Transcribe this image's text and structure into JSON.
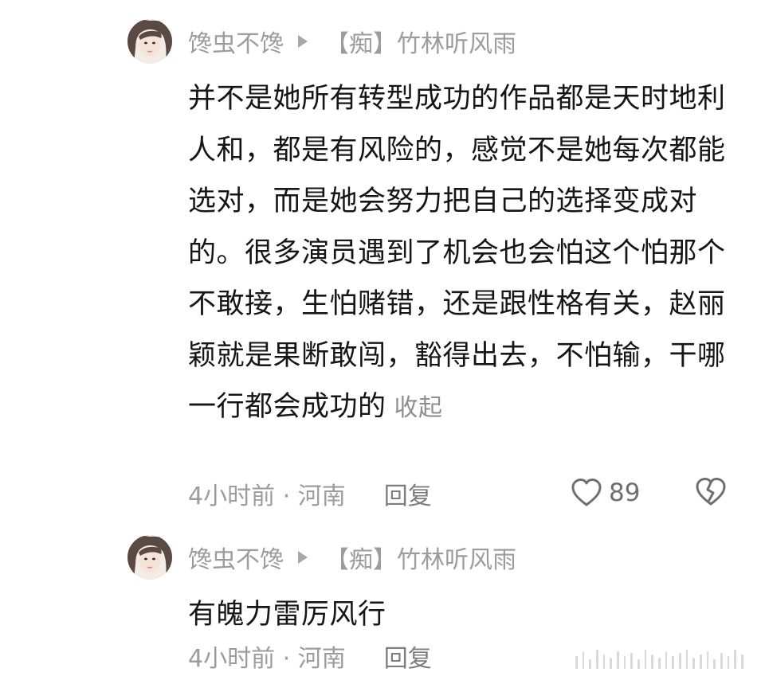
{
  "comments": [
    {
      "author": "馋虫不馋",
      "reply_target": "【痴】竹林听风雨",
      "text": "并不是她所有转型成功的作品都是天时地利人和，都是有风险的，感觉不是她每次都能选对，而是她会努力把自己的选择变成对的。很多演员遇到了机会也会怕这个怕那个不敢接，生怕赌错，还是跟性格有关，赵丽颖就是果断敢闯，豁得出去，不怕输，干哪一行都会成功的",
      "collapse_label": "收起",
      "time_location": "4小时前 · 河南",
      "reply_label": "回复",
      "like_count": "89"
    },
    {
      "author": "馋虫不馋",
      "reply_target": "【痴】竹林听风雨",
      "text": "有魄力雷厉风行",
      "time_location": "4小时前 · 河南",
      "reply_label": "回复"
    }
  ],
  "icons": {
    "reply_arrow": "play-triangle-icon",
    "like": "heart-outline-icon",
    "dislike": "broken-heart-icon",
    "watermark": "barcode-watermark-icon"
  },
  "colors": {
    "text_primary": "#161616",
    "text_secondary": "#9c9c9c",
    "background": "#ffffff"
  }
}
